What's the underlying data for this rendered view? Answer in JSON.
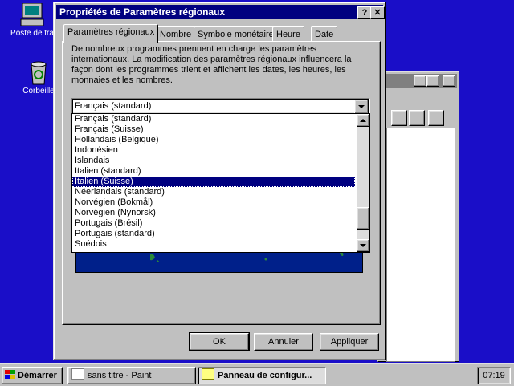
{
  "desktop": {
    "icons": [
      {
        "label": "Poste de tra"
      },
      {
        "label": "Corbeille"
      }
    ]
  },
  "dialog": {
    "title": "Propriétés de Paramètres régionaux",
    "help_btn": "?",
    "close_btn": "✕",
    "tabs": [
      "Paramètres régionaux",
      "Nombre",
      "Symbole monétaire",
      "Heure",
      "Date"
    ],
    "active_tab": 0,
    "description": "De nombreux programmes prennent en charge les paramètres internationaux. La modification des paramètres régionaux influencera la façon dont les programmes trient et affichent les dates, les heures, les monnaies et les nombres.",
    "combo_value": "Français (standard)",
    "list_items": [
      "Français (standard)",
      "Français (Suisse)",
      "Hollandais (Belgique)",
      "Indonésien",
      "Islandais",
      "Italien (standard)",
      "Italien (Suisse)",
      "Néerlandais (standard)",
      "Norvégien (Bokmål)",
      "Norvégien (Nynorsk)",
      "Portugais (Brésil)",
      "Portugais (standard)",
      "Suédois"
    ],
    "selected_index": 6,
    "buttons": {
      "ok": "OK",
      "cancel": "Annuler",
      "apply": "Appliquer"
    }
  },
  "taskbar": {
    "start": "Démarrer",
    "tasks": [
      "sans titre - Paint",
      "Panneau de configur..."
    ],
    "active_task": 1,
    "clock": "07:19"
  }
}
